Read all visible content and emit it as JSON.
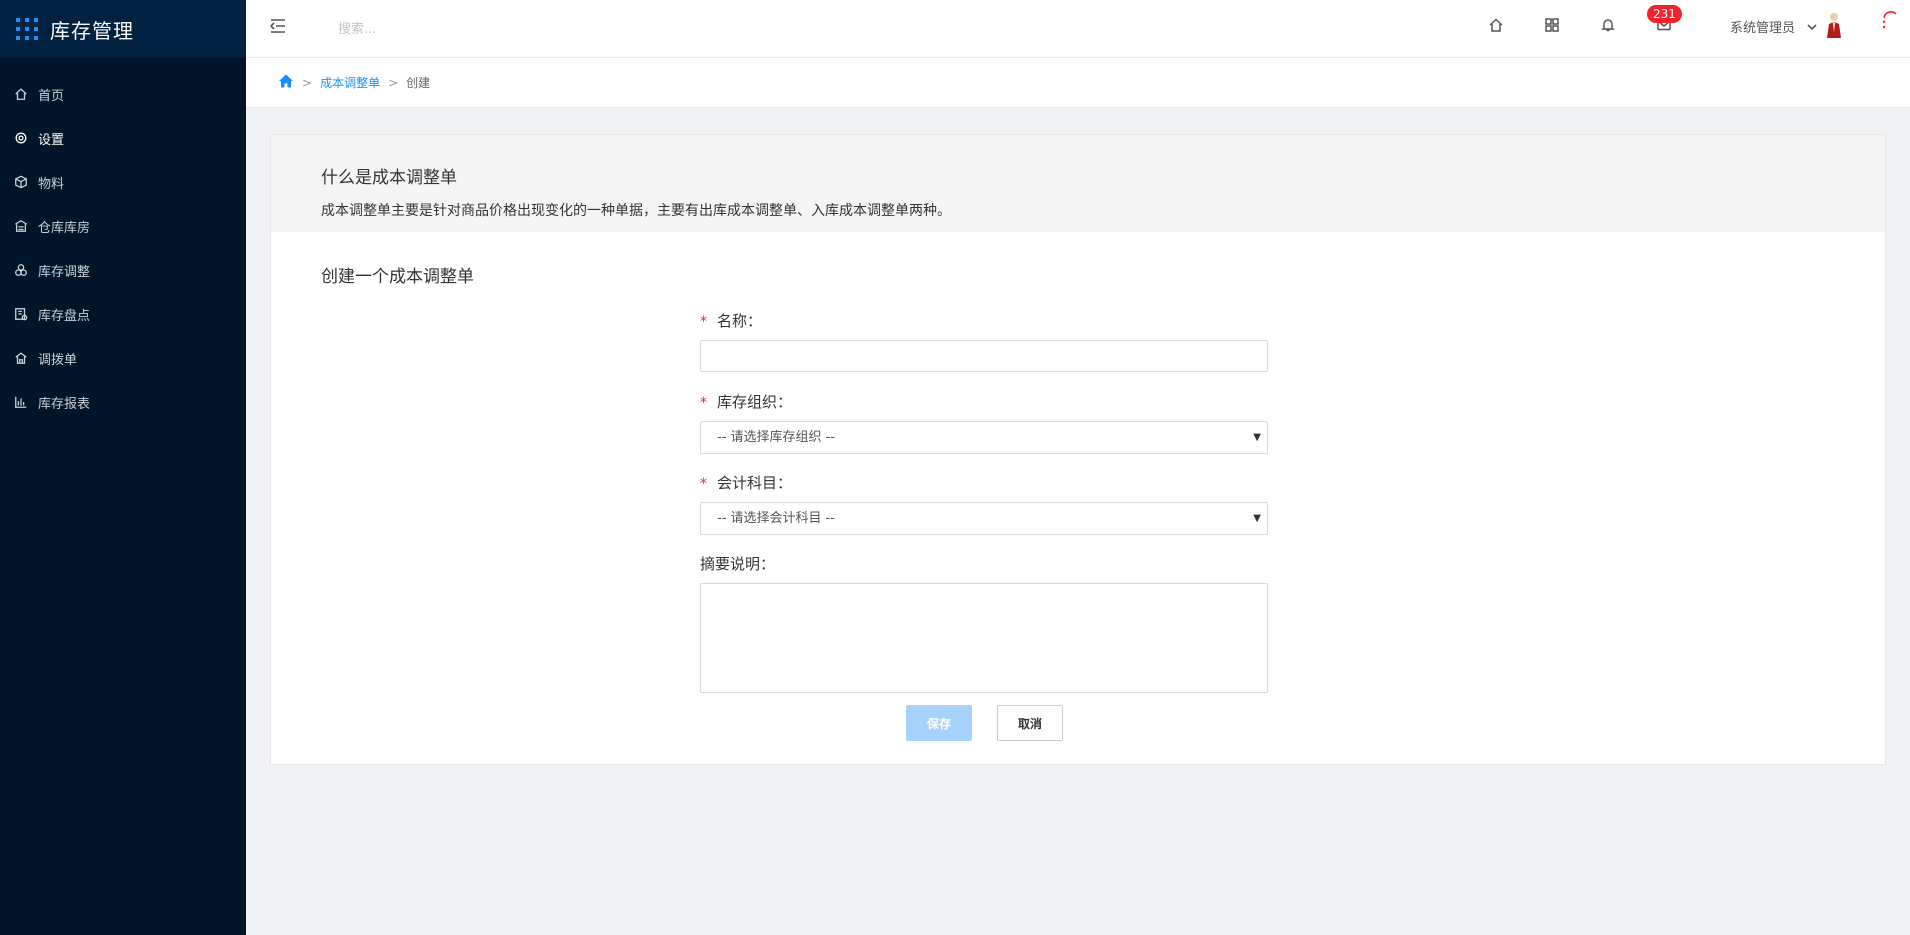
{
  "app": {
    "title": "库存管理",
    "accent": "#1890ff",
    "sidebar_bg": "#001529"
  },
  "sidebar": {
    "items": [
      {
        "label": "首页",
        "icon": "home-icon"
      },
      {
        "label": "设置",
        "icon": "gear-icon"
      },
      {
        "label": "物料",
        "icon": "box-icon"
      },
      {
        "label": "仓库库房",
        "icon": "warehouse-icon"
      },
      {
        "label": "库存调整",
        "icon": "adjust-icon"
      },
      {
        "label": "库存盘点",
        "icon": "inventory-icon"
      },
      {
        "label": "调拨单",
        "icon": "transfer-icon"
      },
      {
        "label": "库存报表",
        "icon": "bar-chart-icon"
      }
    ]
  },
  "topbar": {
    "search_placeholder": "搜索...",
    "mail_badge": "231",
    "user_name": "系统管理员"
  },
  "breadcrumb": {
    "link": "成本调整单",
    "current": "创建",
    "separator": ">"
  },
  "intro": {
    "title": "什么是成本调整单",
    "text": "成本调整单主要是针对商品价格出现变化的一种单据，主要有出库成本调整单、入库成本调整单两种。"
  },
  "form": {
    "title": "创建一个成本调整单",
    "required_mark": "*",
    "name_label": "名称：",
    "org_label": "库存组织：",
    "org_placeholder": "-- 请选择库存组织 --",
    "account_label": "会计科目：",
    "account_placeholder": "-- 请选择会计科目 --",
    "summary_label": "摘要说明：",
    "save_label": "保存",
    "cancel_label": "取消"
  }
}
